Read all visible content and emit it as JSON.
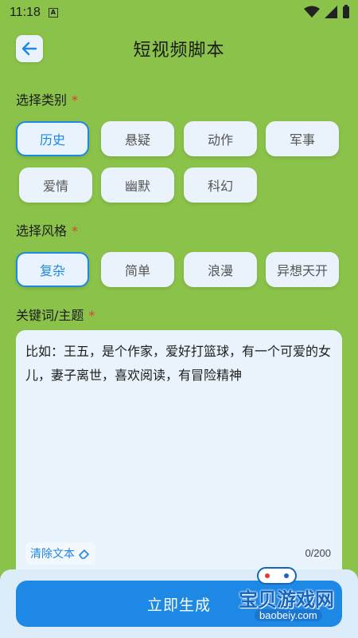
{
  "status_bar": {
    "time": "11:18",
    "notification_icon": "a-icon"
  },
  "header": {
    "title": "短视频脚本",
    "back_icon": "arrow-left-icon"
  },
  "category": {
    "label": "选择类别",
    "required_mark": "*",
    "options": [
      "历史",
      "悬疑",
      "动作",
      "军事",
      "爱情",
      "幽默",
      "科幻"
    ],
    "selected": "历史"
  },
  "style": {
    "label": "选择风格",
    "required_mark": "*",
    "options": [
      "复杂",
      "简单",
      "浪漫",
      "异想天开"
    ],
    "selected": "复杂"
  },
  "keywords": {
    "label": "关键词/主题",
    "required_mark": "*",
    "placeholder": "比如：王五，是个作家，爱好打篮球，有一个可爱的女儿，妻子离世，喜欢阅读，有冒险精神",
    "clear_label": "清除文本",
    "counter": "0/200"
  },
  "generate_button": "立即生成",
  "watermark": {
    "title": "宝贝游戏网",
    "url": "baobeiy.com"
  },
  "colors": {
    "background": "#8bc34a",
    "accent": "#1e88e5",
    "chip": "#eaf3fb",
    "required": "#e53935"
  }
}
